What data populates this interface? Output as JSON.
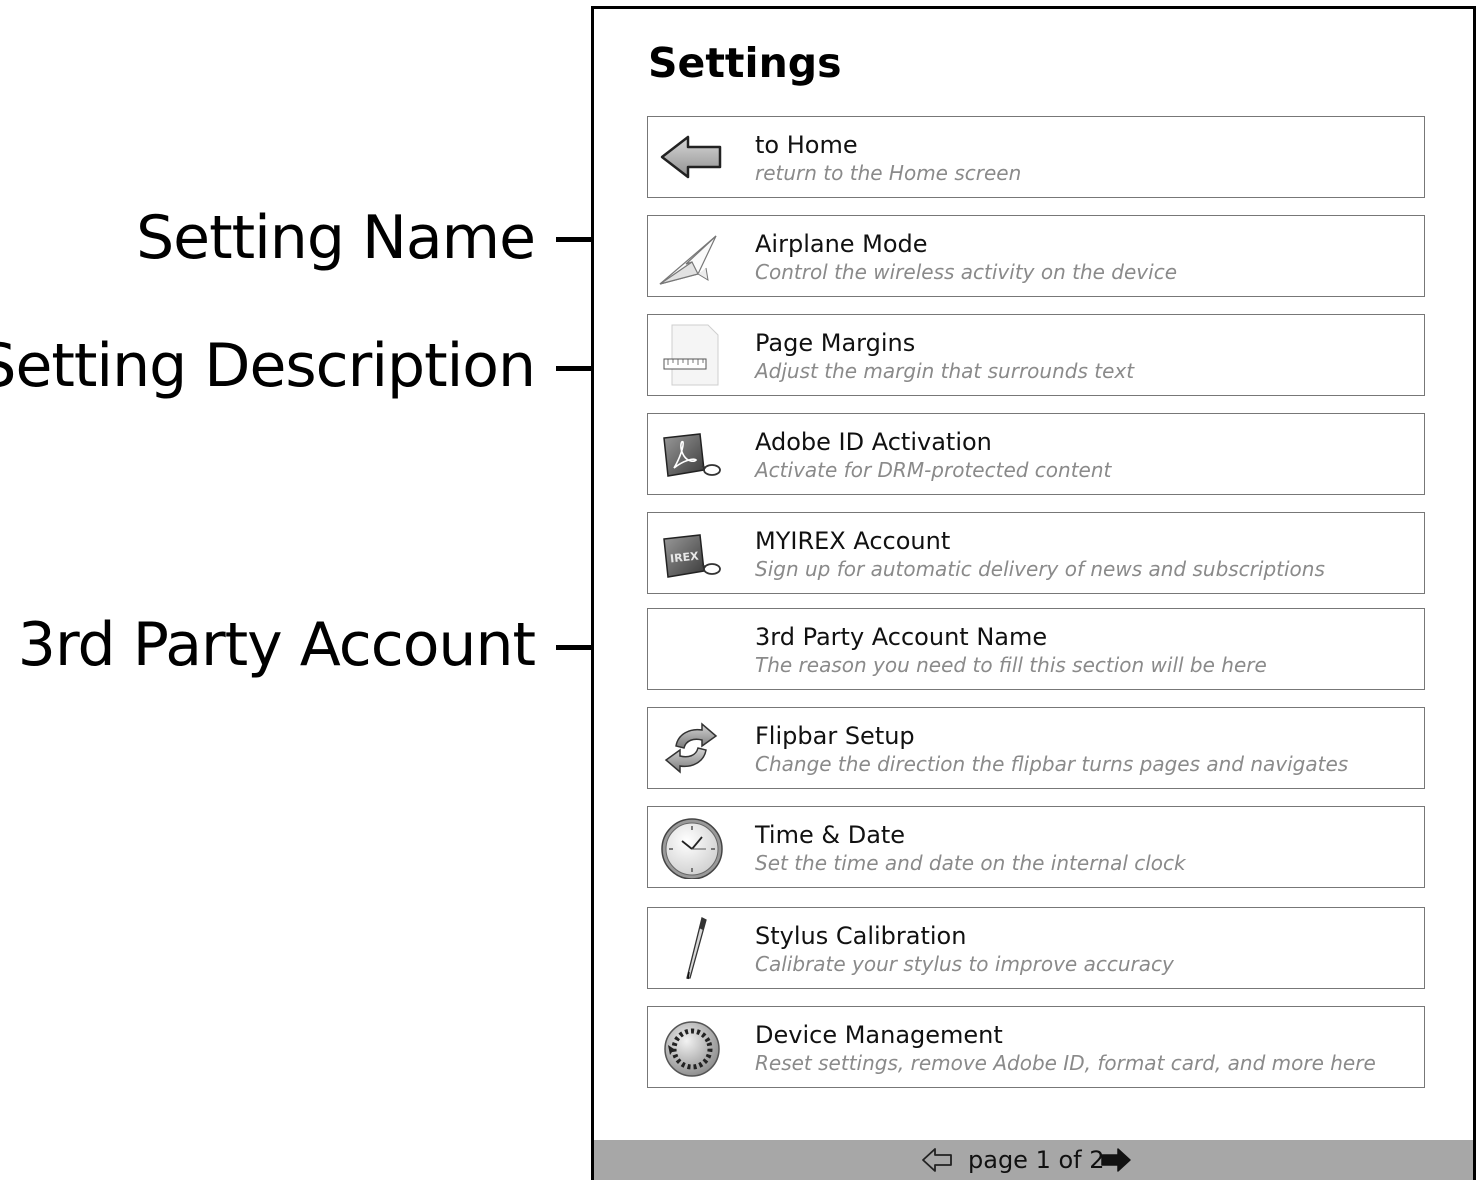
{
  "screen": {
    "title": "Settings",
    "items": [
      {
        "name": "to Home",
        "description": "return to the Home screen",
        "icon": "back-arrow-icon"
      },
      {
        "name": "Airplane Mode",
        "description": "Control the wireless activity on the device",
        "icon": "paper-airplane-icon"
      },
      {
        "name": "Page Margins",
        "description": "Adjust the margin that surrounds text",
        "icon": "page-margin-icon"
      },
      {
        "name": "Adobe ID Activation",
        "description": "Activate for DRM-protected content",
        "icon": "adobe-tag-icon"
      },
      {
        "name": "MYIREX Account",
        "description": "Sign up for automatic delivery of news and subscriptions",
        "icon": "irex-tag-icon",
        "icon_text": "IREX"
      },
      {
        "name": "3rd Party Account Name",
        "description": "The reason you need to fill this section will be here",
        "icon": ""
      },
      {
        "name": "Flipbar Setup",
        "description": "Change the direction the flipbar turns pages and navigates",
        "icon": "flip-arrows-icon"
      },
      {
        "name": "Time & Date",
        "description": "Set the time and date on the internal clock",
        "icon": "clock-icon"
      },
      {
        "name": "Stylus Calibration",
        "description": "Calibrate your stylus to improve accuracy",
        "icon": "stylus-icon"
      },
      {
        "name": "Device Management",
        "description": "Reset settings, remove Adobe ID, format card, and more here",
        "icon": "device-reset-icon"
      }
    ]
  },
  "pager": {
    "label": "page 1 of 2",
    "prev_icon": "arrow-left-outline-icon",
    "next_icon": "arrow-right-filled-icon"
  },
  "annotations": {
    "setting_name": "Setting Name",
    "setting_description": "Setting Description",
    "third_party_account": "3rd Party Account"
  }
}
